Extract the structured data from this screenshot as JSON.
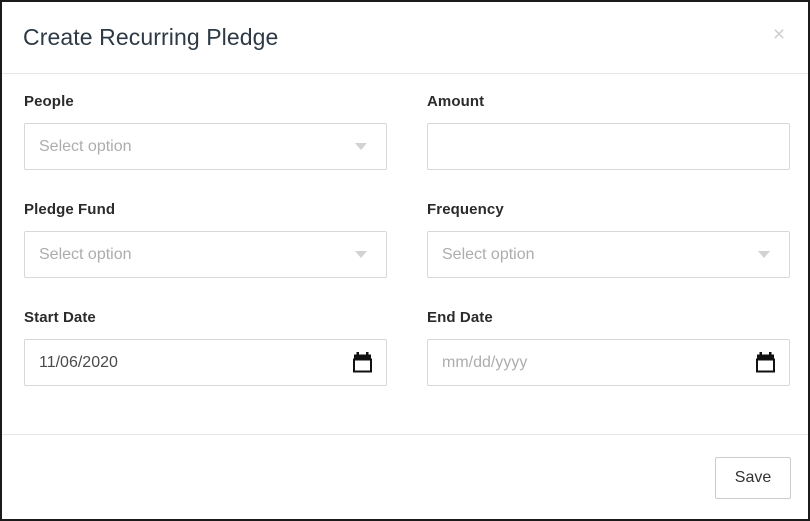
{
  "dialog": {
    "title": "Create Recurring Pledge",
    "close_label": "×",
    "close_icon": "close-icon"
  },
  "form": {
    "rows": [
      {
        "left": {
          "label": "People",
          "type": "select",
          "value": "",
          "placeholder": "Select option",
          "icon": "chevron-down-icon"
        },
        "right": {
          "label": "Amount",
          "type": "text",
          "value": "",
          "placeholder": ""
        }
      },
      {
        "left": {
          "label": "Pledge Fund",
          "type": "select",
          "value": "",
          "placeholder": "Select option",
          "icon": "chevron-down-icon"
        },
        "right": {
          "label": "Frequency",
          "type": "select",
          "value": "",
          "placeholder": "Select option",
          "icon": "chevron-down-icon"
        }
      },
      {
        "left": {
          "label": "Start Date",
          "type": "date",
          "value": "11/06/2020",
          "placeholder": "mm/dd/yyyy",
          "icon": "calendar-icon"
        },
        "right": {
          "label": "End Date",
          "type": "date",
          "value": "",
          "placeholder": "mm/dd/yyyy",
          "icon": "calendar-icon"
        }
      }
    ]
  },
  "footer": {
    "save_label": "Save"
  },
  "colors": {
    "title_text": "#2d3a45",
    "label_text": "#2b2b2b",
    "placeholder_text": "#adadad",
    "value_text": "#4a4a4a",
    "border": "#d8d8d8",
    "divider": "#e6e6e6",
    "frame": "#1b1b1b"
  }
}
